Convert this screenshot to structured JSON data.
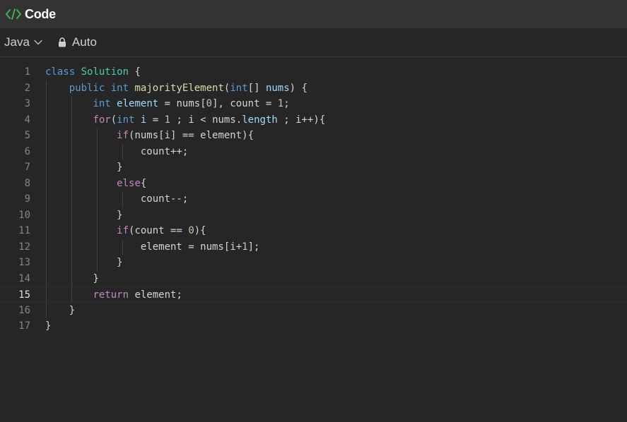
{
  "window": {
    "title": "Code",
    "icon": "code-icon",
    "accent": "#3fb950"
  },
  "toolbar": {
    "language": "Java",
    "language_icon": "chevron-down-icon",
    "mode": "Auto",
    "mode_icon": "lock-icon"
  },
  "editor": {
    "active_line": 15,
    "lines": [
      {
        "n": "1",
        "tokens": [
          {
            "t": "class",
            "c": "kw2"
          },
          {
            "t": " ",
            "c": "pl"
          },
          {
            "t": "Solution",
            "c": "ty"
          },
          {
            "t": " {",
            "c": "pl"
          }
        ]
      },
      {
        "n": "2",
        "tokens": [
          {
            "t": "    ",
            "c": "pl"
          },
          {
            "t": "public",
            "c": "kw2"
          },
          {
            "t": " ",
            "c": "pl"
          },
          {
            "t": "int",
            "c": "kw2"
          },
          {
            "t": " ",
            "c": "pl"
          },
          {
            "t": "majorityElement",
            "c": "fn"
          },
          {
            "t": "(",
            "c": "pl"
          },
          {
            "t": "int",
            "c": "kw2"
          },
          {
            "t": "[] ",
            "c": "pl"
          },
          {
            "t": "nums",
            "c": "var"
          },
          {
            "t": ") {",
            "c": "pl"
          }
        ]
      },
      {
        "n": "3",
        "tokens": [
          {
            "t": "        ",
            "c": "pl"
          },
          {
            "t": "int",
            "c": "kw2"
          },
          {
            "t": " ",
            "c": "pl"
          },
          {
            "t": "element",
            "c": "var"
          },
          {
            "t": " = nums[",
            "c": "pl"
          },
          {
            "t": "0",
            "c": "num"
          },
          {
            "t": "], count = ",
            "c": "pl"
          },
          {
            "t": "1",
            "c": "num"
          },
          {
            "t": ";",
            "c": "pl"
          }
        ]
      },
      {
        "n": "4",
        "tokens": [
          {
            "t": "        ",
            "c": "pl"
          },
          {
            "t": "for",
            "c": "kw"
          },
          {
            "t": "(",
            "c": "pl"
          },
          {
            "t": "int",
            "c": "kw2"
          },
          {
            "t": " ",
            "c": "pl"
          },
          {
            "t": "i",
            "c": "var"
          },
          {
            "t": " = ",
            "c": "pl"
          },
          {
            "t": "1",
            "c": "num"
          },
          {
            "t": " ; i < nums.",
            "c": "pl"
          },
          {
            "t": "length",
            "c": "var"
          },
          {
            "t": " ; i++){",
            "c": "pl"
          }
        ]
      },
      {
        "n": "5",
        "tokens": [
          {
            "t": "            ",
            "c": "pl"
          },
          {
            "t": "if",
            "c": "kw"
          },
          {
            "t": "(nums[i] == element){",
            "c": "pl"
          }
        ]
      },
      {
        "n": "6",
        "tokens": [
          {
            "t": "                ",
            "c": "pl"
          },
          {
            "t": "count++;",
            "c": "pl"
          }
        ]
      },
      {
        "n": "7",
        "tokens": [
          {
            "t": "            ",
            "c": "pl"
          },
          {
            "t": "}",
            "c": "pl"
          }
        ]
      },
      {
        "n": "8",
        "tokens": [
          {
            "t": "            ",
            "c": "pl"
          },
          {
            "t": "else",
            "c": "kw"
          },
          {
            "t": "{",
            "c": "pl"
          }
        ]
      },
      {
        "n": "9",
        "tokens": [
          {
            "t": "                ",
            "c": "pl"
          },
          {
            "t": "count--;",
            "c": "pl"
          }
        ]
      },
      {
        "n": "10",
        "tokens": [
          {
            "t": "            ",
            "c": "pl"
          },
          {
            "t": "}",
            "c": "pl"
          }
        ]
      },
      {
        "n": "11",
        "tokens": [
          {
            "t": "            ",
            "c": "pl"
          },
          {
            "t": "if",
            "c": "kw"
          },
          {
            "t": "(count == ",
            "c": "pl"
          },
          {
            "t": "0",
            "c": "num"
          },
          {
            "t": "){",
            "c": "pl"
          }
        ]
      },
      {
        "n": "12",
        "tokens": [
          {
            "t": "                ",
            "c": "pl"
          },
          {
            "t": "element = nums[i+",
            "c": "pl"
          },
          {
            "t": "1",
            "c": "num"
          },
          {
            "t": "];",
            "c": "pl"
          }
        ]
      },
      {
        "n": "13",
        "tokens": [
          {
            "t": "            ",
            "c": "pl"
          },
          {
            "t": "}",
            "c": "pl"
          }
        ]
      },
      {
        "n": "14",
        "tokens": [
          {
            "t": "        ",
            "c": "pl"
          },
          {
            "t": "}",
            "c": "pl"
          }
        ]
      },
      {
        "n": "15",
        "tokens": [
          {
            "t": "        ",
            "c": "pl"
          },
          {
            "t": "return",
            "c": "kw"
          },
          {
            "t": " element;",
            "c": "pl"
          }
        ]
      },
      {
        "n": "16",
        "tokens": [
          {
            "t": "    ",
            "c": "pl"
          },
          {
            "t": "}",
            "c": "pl"
          }
        ]
      },
      {
        "n": "17",
        "tokens": [
          {
            "t": "}",
            "c": "pl"
          }
        ]
      }
    ]
  }
}
